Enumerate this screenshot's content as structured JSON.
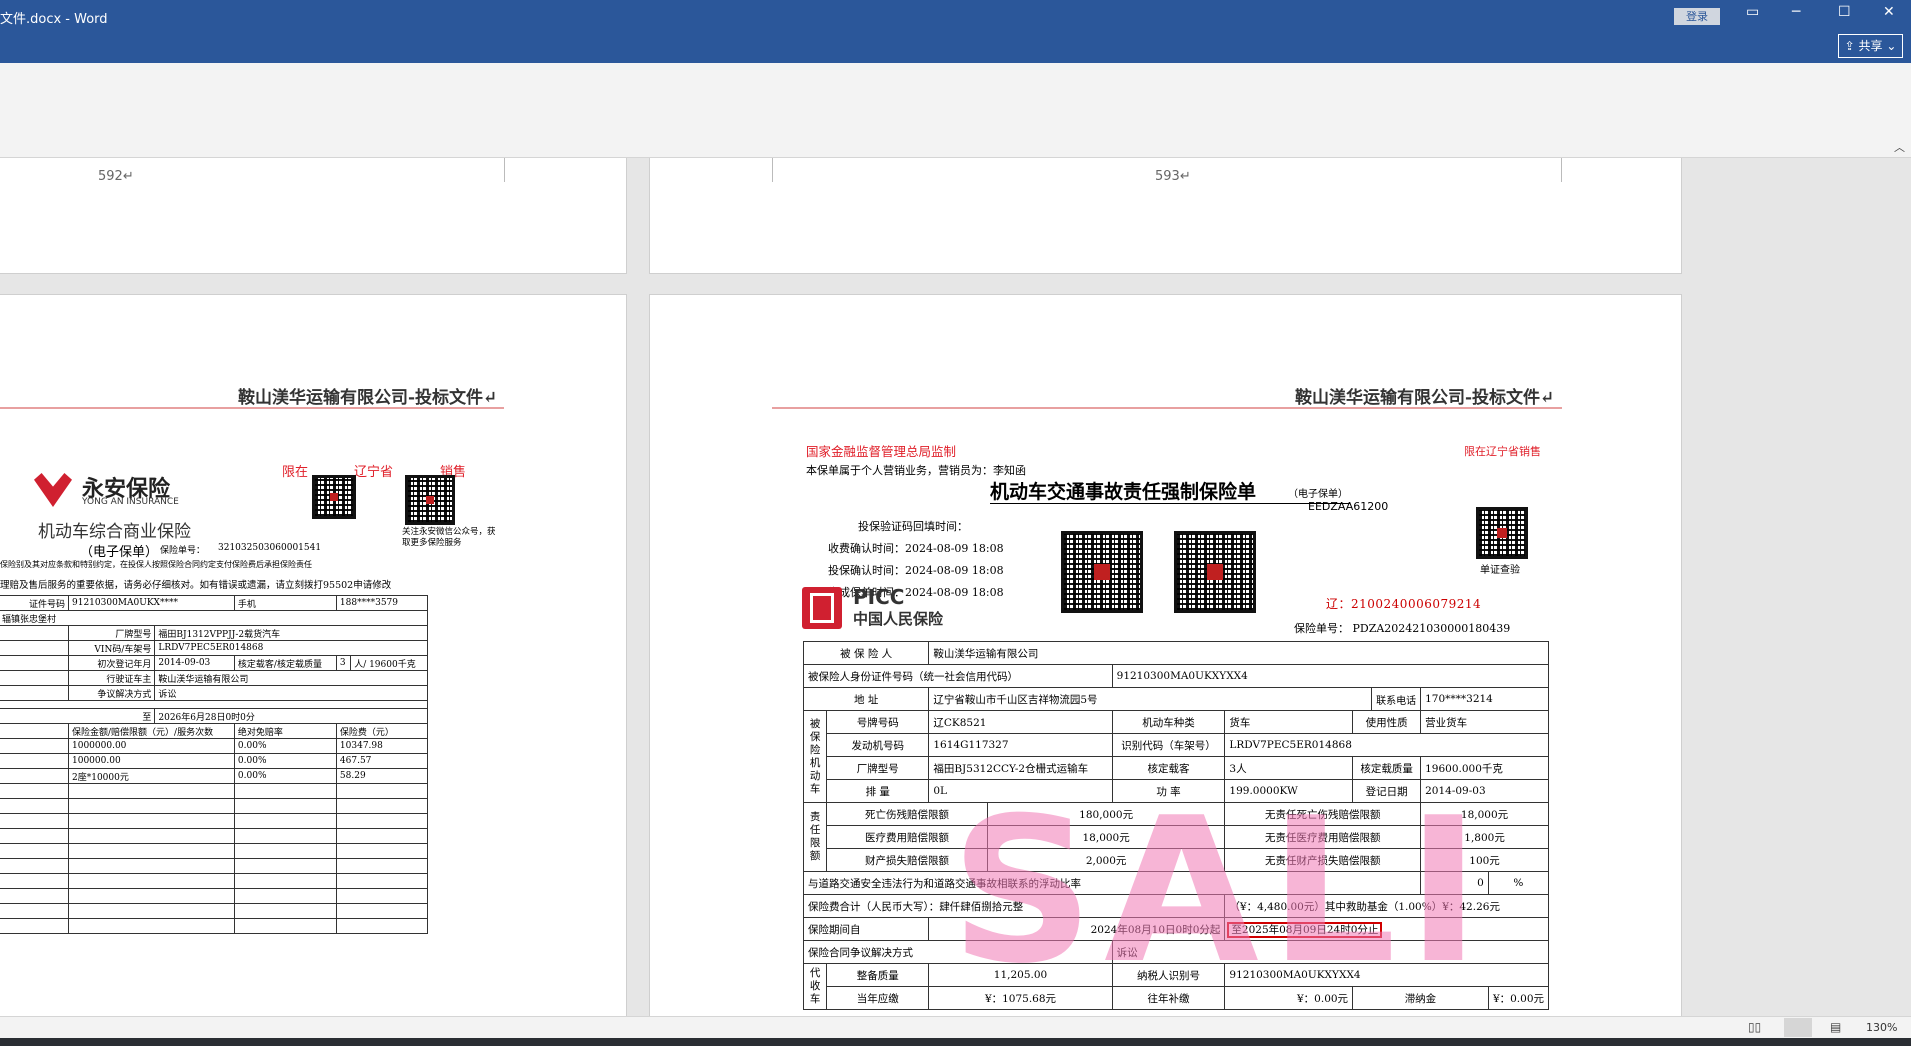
{
  "window": {
    "title": "文件.docx  -  Word",
    "login": "登录",
    "share": "共享"
  },
  "status": {
    "zoom": "130%"
  },
  "pages": {
    "p592": "592↵",
    "p593": "593↵"
  },
  "header": {
    "company": "鞍山渼华运输有限公司-投标文件↵"
  },
  "left": {
    "restrict": [
      "限在",
      "辽宁省",
      "销售"
    ],
    "brand": "永安保险",
    "brand_en": "YONG AN INSURANCE",
    "title": "机动车综合商业保险",
    "sub": "（电子保单）",
    "policy_no_label": "保险单号：",
    "policy_no": "321032503060001541",
    "wechat": "关注永安微信公众号，获取更多保险服务",
    "note1": "保险别及其对应条款和特别约定，在投保人按照保险合同约定支付保险费后承担保险责任",
    "note2": "理赔及售后服务的重要依据，请务必仔细核对。如有错误或遗漏，请立刻拨打95502申请修改",
    "id_label": "证件号码",
    "id_value": "91210300MA0UKX****",
    "phone_label": "手机",
    "phone_value": "188****3579",
    "addr": "辐镇张忠堡村",
    "brand_model_label": "厂牌型号",
    "brand_model": "福田BJ1312VPPJJ-2载货汽车",
    "vin_label": "VIN码/车架号",
    "vin": "LRDV7PEC5ER014868",
    "reg_label": "初次登记年月",
    "reg": "2014-09-03",
    "cap_label": "核定载客/核定载质量",
    "cap1": "3",
    "cap2": "人/ 19600千克",
    "owner_label": "行驶证车主",
    "owner": "鞍山渼华运输有限公司",
    "dispute_label": "争议解决方式",
    "dispute": "诉讼",
    "period_to": "至",
    "period": "2026年6月28日0时0分",
    "cols": [
      "保险金额/赔偿限额（元）/服务次数",
      "绝对免赔率",
      "保险费（元）"
    ],
    "rows": [
      [
        "1000000.00",
        "0.00%",
        "10347.98"
      ],
      [
        "100000.00",
        "0.00%",
        "467.57"
      ],
      [
        "2座*10000元",
        "0.00%",
        "58.29"
      ]
    ]
  },
  "right": {
    "supervise": "国家金融监督管理总局监制",
    "restrict": "限在辽宁省销售",
    "agent": "本保单属于个人营销业务，营销员为：李知函",
    "title": "机动车交通事故责任强制保险单",
    "title_sub": "（电子保单）",
    "code": "EEDZAA61200",
    "fill_time": "投保验证码回填时间：",
    "pay_time": "收费确认时间：2024-08-09  18:08",
    "apply_time": "投保确认时间：2024-08-09  18:08",
    "gen_time": "生成保单时间：2024-08-09  18:08",
    "verify": "单证查验",
    "liao": "辽：2100240006079214",
    "policy": "保险单号：  PDZA202421030000180439",
    "picc": "PICC",
    "picc_cn": "中国人民保险",
    "insured_label": "被 保 险 人",
    "insured": "鞍山渼华运输有限公司",
    "idcode_label": "被保险人身份证件号码（统一社会信用代码）",
    "idcode": "91210300MA0UKXYXX4",
    "addr_label": "地    址",
    "addr": "辽宁省鞍山市千山区吉祥物流园5号",
    "tel_label": "联系电话",
    "tel": "170****3214",
    "side_car": "被保险机动车",
    "plate_label": "号牌号码",
    "plate": "辽CK8521",
    "type_label": "机动车种类",
    "type": "货车",
    "use_label": "使用性质",
    "use": "营业货车",
    "engine_label": "发动机号码",
    "engine": "1614G117327",
    "vin_label": "识别代码（车架号）",
    "vin": "LRDV7PEC5ER014868",
    "model_label": "厂牌型号",
    "model": "福田BJ5312CCY-2仓栅式运输车",
    "seat_label": "核定载客",
    "seat": "3人",
    "load_label": "核定载质量",
    "load": "19600.000千克",
    "disp_label": "排    量",
    "disp": "0L",
    "power_label": "功  率",
    "power": "199.0000KW",
    "regdate_label": "登记日期",
    "regdate": "2014-09-03",
    "side_limit": "责任限额",
    "death_label": "死亡伤残赔偿限额",
    "death": "180,000元",
    "nodeath_label": "无责任死亡伤残赔偿限额",
    "nodeath": "18,000元",
    "med_label": "医疗费用赔偿限额",
    "med": "18,000元",
    "nomed_label": "无责任医疗费用赔偿限额",
    "nomed": "1,800元",
    "prop_label": "财产损失赔偿限额",
    "prop": "2,000元",
    "noprop_label": "无责任财产损失赔偿限额",
    "noprop": "100元",
    "float_label": "与道路交通安全违法行为和道路交通事故相联系的浮动比率",
    "float_val": "0",
    "pct": "%",
    "total_label": "保险费合计（人民币大写）：肆仟肆佰捌拾元整",
    "total_val": "（¥：4,480.00元）其中救助基金（1.00%）¥：42.26元",
    "period_label": "保险期间自",
    "period_from": "2024年08月10日0时0分起",
    "period_to": "至2025年08月09日24时0分止",
    "contract_label": "保险合同争议解决方式",
    "contract": "诉讼",
    "side_tax": "代收车",
    "curb_label": "整备质量",
    "curb": "11,205.00",
    "taxid_label": "纳税人识别号",
    "taxid": "91210300MA0UKXYXX4",
    "cur_label": "当年应缴",
    "cur": "¥：1075.68元",
    "past_label": "往年补缴",
    "past": "¥：0.00元",
    "late_label": "滞纳金",
    "late": "¥：0.00元",
    "watermark": "SALI"
  }
}
